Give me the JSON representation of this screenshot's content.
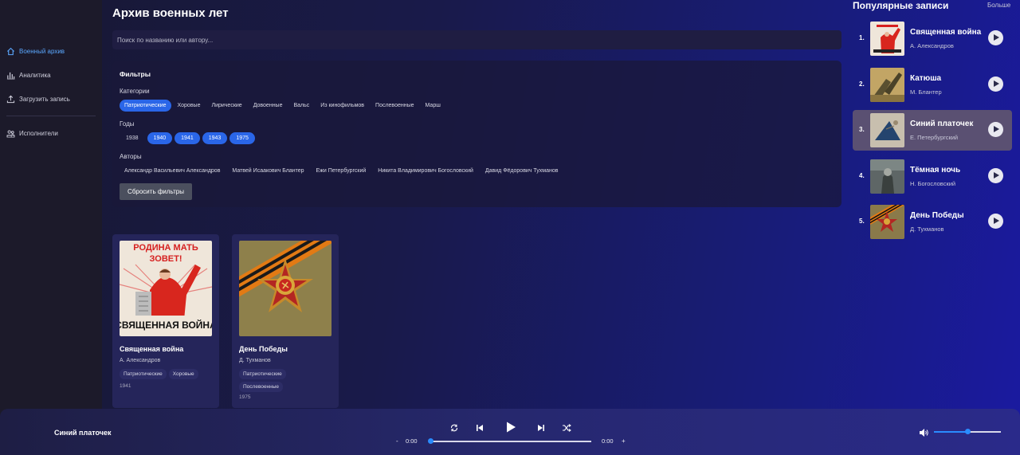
{
  "sidebar": {
    "items": [
      {
        "label": "Военный архив",
        "icon": "home-icon",
        "active": true
      },
      {
        "label": "Аналитика",
        "icon": "analytics-icon",
        "active": false
      },
      {
        "label": "Загрузить запись",
        "icon": "upload-icon",
        "active": false
      },
      {
        "label": "Исполнители",
        "icon": "performers-icon",
        "active": false
      }
    ]
  },
  "main": {
    "title": "Архив военных лет",
    "search_placeholder": "Поиск по названию или автору..."
  },
  "filters": {
    "title": "Фильтры",
    "categories_label": "Категории",
    "categories": [
      {
        "label": "Патриотические",
        "selected": true
      },
      {
        "label": "Хоровые",
        "selected": false
      },
      {
        "label": "Лирические",
        "selected": false
      },
      {
        "label": "Довоенные",
        "selected": false
      },
      {
        "label": "Вальс",
        "selected": false
      },
      {
        "label": "Из кинофильмов",
        "selected": false
      },
      {
        "label": "Послевоенные",
        "selected": false
      },
      {
        "label": "Марш",
        "selected": false
      }
    ],
    "years_label": "Годы",
    "years": [
      {
        "label": "1938",
        "selected": false
      },
      {
        "label": "1940",
        "selected": true
      },
      {
        "label": "1941",
        "selected": true
      },
      {
        "label": "1943",
        "selected": true
      },
      {
        "label": "1975",
        "selected": true
      }
    ],
    "authors_label": "Авторы",
    "authors": [
      {
        "label": "Александр Васильевич Александров",
        "selected": false
      },
      {
        "label": "Матвей Исаакович Блантер",
        "selected": false
      },
      {
        "label": "Ежи Петербургский",
        "selected": false
      },
      {
        "label": "Никита Владимирович Богословский",
        "selected": false
      },
      {
        "label": "Давид Фёдорович Тухманов",
        "selected": false
      }
    ],
    "reset_label": "Сбросить фильтры"
  },
  "cards": [
    {
      "title": "Священная война",
      "author": "А. Александров",
      "tags": [
        "Патриотические",
        "Хоровые"
      ],
      "year": "1941",
      "poster_text_top": "РОДИНА МАТЬ",
      "poster_text_mid": "ЗОВЕТ!",
      "poster_text_bottom": "СВЯЩЕННАЯ ВОЙНА"
    },
    {
      "title": "День Победы",
      "author": "Д. Тухманов",
      "tags": [
        "Патриотические",
        "Послевоенные"
      ],
      "year": "1975"
    }
  ],
  "popular": {
    "title": "Популярные записи",
    "more_label": "Больше",
    "items": [
      {
        "num": "1.",
        "name": "Священная война",
        "artist": "А. Александров",
        "active": false
      },
      {
        "num": "2.",
        "name": "Катюша",
        "artist": "М. Блантер",
        "active": false
      },
      {
        "num": "3.",
        "name": "Синий платочек",
        "artist": "Е. Петербургский",
        "active": true
      },
      {
        "num": "4.",
        "name": "Тёмная ночь",
        "artist": "Н. Богословский",
        "active": false
      },
      {
        "num": "5.",
        "name": "День Победы",
        "artist": "Д. Тухманов",
        "active": false
      }
    ]
  },
  "player": {
    "track": "Синий платочек",
    "current_time": "0:00",
    "duration": "0:00",
    "minus_label": "-",
    "plus_label": "+",
    "progress": 0,
    "volume": 0.5
  },
  "colors": {
    "accent": "#2a66e8",
    "active_nav": "#5ba8ff",
    "slider": "#2a8cff"
  }
}
